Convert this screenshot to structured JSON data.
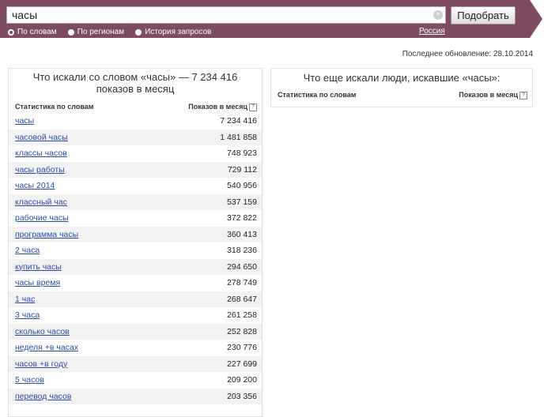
{
  "search": {
    "query": "часы",
    "submit_label": "Подобрать"
  },
  "modes": [
    {
      "label": "По словам",
      "checked": true
    },
    {
      "label": "По регионам",
      "checked": false
    },
    {
      "label": "История запросов",
      "checked": false
    }
  ],
  "region": "Россия",
  "last_update": "Последнее обновление: 28.10.2014",
  "left_panel": {
    "title": "Что искали со словом «часы» — 7 234 416 показов в месяц",
    "col_keyword": "Статистика по словам",
    "col_count": "Показов в месяц",
    "help": "?",
    "rows": [
      {
        "kw": "часы",
        "count": "7 234 416"
      },
      {
        "kw": "часовой часы",
        "count": "1 481 858"
      },
      {
        "kw": "классы часов",
        "count": "748 923"
      },
      {
        "kw": "часы работы",
        "count": "729 112"
      },
      {
        "kw": "часы 2014",
        "count": "540 956"
      },
      {
        "kw": "классный час",
        "count": "537 159"
      },
      {
        "kw": "рабочие часы",
        "count": "372 822"
      },
      {
        "kw": "программа часы",
        "count": "360 413"
      },
      {
        "kw": "2 часа",
        "count": "318 236"
      },
      {
        "kw": "купить часы",
        "count": "294 650"
      },
      {
        "kw": "часы время",
        "count": "278 749"
      },
      {
        "kw": "1 час",
        "count": "268 647"
      },
      {
        "kw": "3 часа",
        "count": "261 258"
      },
      {
        "kw": "сколько часов",
        "count": "252 828"
      },
      {
        "kw": "неделя +в часах",
        "count": "230 776"
      },
      {
        "kw": "часов +в году",
        "count": "227 699"
      },
      {
        "kw": "5 часов",
        "count": "209 200"
      },
      {
        "kw": "перевод часов",
        "count": "203 356"
      }
    ]
  },
  "right_panel": {
    "title": "Что еще искали люди, искавшие «часы»:",
    "col_keyword": "Статистика по словам",
    "col_count": "Показов в месяц",
    "help": "?"
  }
}
